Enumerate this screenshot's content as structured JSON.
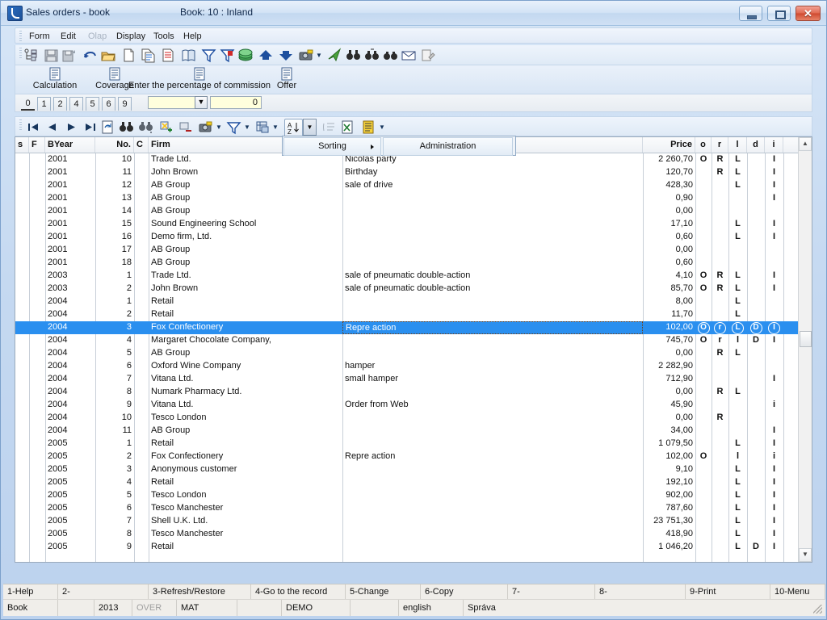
{
  "window": {
    "title": "Sales orders - book",
    "book_label": "Book: 10 : Inland",
    "app_icon": "book-app-icon",
    "minimize": "–",
    "maximize": "□",
    "close": "✕"
  },
  "menubar": {
    "items": [
      {
        "label": "Form",
        "disabled": false
      },
      {
        "label": "Edit",
        "disabled": false
      },
      {
        "label": "Olap",
        "disabled": true
      },
      {
        "label": "Display",
        "disabled": false
      },
      {
        "label": "Tools",
        "disabled": false
      },
      {
        "label": "Help",
        "disabled": false
      }
    ]
  },
  "toolbar_main": {
    "icons": [
      "structure-tree-icon",
      "save-icon",
      "save-lock-icon",
      "undo-icon",
      "open-folder-icon",
      "new-document-icon",
      "copy-document-icon",
      "paste-document-icon",
      "book-icon",
      "filter-icon",
      "filter-remove-icon",
      "money-stack-icon",
      "move-up-icon",
      "move-down-icon",
      "camera-icon",
      "camera-dropdown-icon",
      "mail-send-icon",
      "binoculars-icon",
      "binoculars-next-icon",
      "binoculars-prev-icon",
      "envelope-icon",
      "edit-note-icon"
    ]
  },
  "toolbar_buttons": {
    "items": [
      {
        "label": "Calculation",
        "icon": "document-icon"
      },
      {
        "label": "Coverage",
        "icon": "document-icon"
      },
      {
        "label": "Enter the percentage of commission",
        "icon": "document-icon"
      },
      {
        "label": "Offer",
        "icon": "document-icon"
      }
    ]
  },
  "tabs": {
    "items": [
      "0",
      "1",
      "2",
      "4",
      "5",
      "6",
      "9"
    ],
    "active": "0",
    "combo_value": "",
    "number_value": "0"
  },
  "toolbar_grid": {
    "icons": [
      "first-record-icon",
      "previous-record-icon",
      "next-record-icon",
      "last-record-icon",
      "refresh-record-icon",
      "find-icon",
      "find-next-icon",
      "add-record-icon",
      "delete-record-icon",
      "camera-icon",
      "filter-icon",
      "grid-layout-icon",
      "sort-az-icon",
      "list-icon",
      "export-excel-icon",
      "report-icon"
    ]
  },
  "dropdown": {
    "sorting_label": "Sorting",
    "administration_label": "Administration",
    "submenu_arrow": "▶"
  },
  "grid": {
    "columns": [
      {
        "key": "s",
        "label": "s",
        "align": "left"
      },
      {
        "key": "f",
        "label": "F",
        "align": "left"
      },
      {
        "key": "byear",
        "label": "BYear",
        "align": "left"
      },
      {
        "key": "no",
        "label": "No.",
        "align": "right"
      },
      {
        "key": "c",
        "label": "C",
        "align": "left"
      },
      {
        "key": "firm",
        "label": "Firm",
        "align": "left"
      },
      {
        "key": "desc",
        "label": "",
        "align": "left"
      },
      {
        "key": "price",
        "label": "Price",
        "align": "right"
      },
      {
        "key": "o",
        "label": "o",
        "align": "center"
      },
      {
        "key": "r",
        "label": "r",
        "align": "center"
      },
      {
        "key": "l",
        "label": "l",
        "align": "center"
      },
      {
        "key": "d",
        "label": "d",
        "align": "center"
      },
      {
        "key": "i",
        "label": "i",
        "align": "center"
      }
    ],
    "rows": [
      {
        "s": "",
        "f": "",
        "byear": "2001",
        "no": "10",
        "c": "",
        "firm": "Trade Ltd.",
        "desc": "Nicolas party",
        "price": "2 260,70",
        "o": "O",
        "r": "R",
        "l": "L",
        "d": "",
        "i": "I",
        "selected": false
      },
      {
        "s": "",
        "f": "",
        "byear": "2001",
        "no": "11",
        "c": "",
        "firm": "John Brown",
        "desc": "Birthday",
        "price": "120,70",
        "o": "",
        "r": "R",
        "l": "L",
        "d": "",
        "i": "I",
        "selected": false
      },
      {
        "s": "",
        "f": "",
        "byear": "2001",
        "no": "12",
        "c": "",
        "firm": "AB Group",
        "desc": "sale of drive",
        "price": "428,30",
        "o": "",
        "r": "",
        "l": "L",
        "d": "",
        "i": "I",
        "selected": false
      },
      {
        "s": "",
        "f": "",
        "byear": "2001",
        "no": "13",
        "c": "",
        "firm": "AB Group",
        "desc": "",
        "price": "0,90",
        "o": "",
        "r": "",
        "l": "",
        "d": "",
        "i": "I",
        "selected": false
      },
      {
        "s": "",
        "f": "",
        "byear": "2001",
        "no": "14",
        "c": "",
        "firm": "AB Group",
        "desc": "",
        "price": "0,00",
        "o": "",
        "r": "",
        "l": "",
        "d": "",
        "i": "",
        "selected": false
      },
      {
        "s": "",
        "f": "",
        "byear": "2001",
        "no": "15",
        "c": "",
        "firm": "Sound Engineering School",
        "desc": "",
        "price": "17,10",
        "o": "",
        "r": "",
        "l": "L",
        "d": "",
        "i": "I",
        "selected": false
      },
      {
        "s": "",
        "f": "",
        "byear": "2001",
        "no": "16",
        "c": "",
        "firm": "Demo firm, Ltd.",
        "desc": "",
        "price": "0,60",
        "o": "",
        "r": "",
        "l": "L",
        "d": "",
        "i": "I",
        "selected": false
      },
      {
        "s": "",
        "f": "",
        "byear": "2001",
        "no": "17",
        "c": "",
        "firm": "AB Group",
        "desc": "",
        "price": "0,00",
        "o": "",
        "r": "",
        "l": "",
        "d": "",
        "i": "",
        "selected": false
      },
      {
        "s": "",
        "f": "",
        "byear": "2001",
        "no": "18",
        "c": "",
        "firm": "AB Group",
        "desc": "",
        "price": "0,60",
        "o": "",
        "r": "",
        "l": "",
        "d": "",
        "i": "",
        "selected": false
      },
      {
        "s": "",
        "f": "",
        "byear": "2003",
        "no": "1",
        "c": "",
        "firm": "Trade Ltd.",
        "desc": "sale of pneumatic double-action",
        "price": "4,10",
        "o": "O",
        "r": "R",
        "l": "L",
        "d": "",
        "i": "I",
        "selected": false
      },
      {
        "s": "",
        "f": "",
        "byear": "2003",
        "no": "2",
        "c": "",
        "firm": "John Brown",
        "desc": "sale of pneumatic double-action",
        "price": "85,70",
        "o": "O",
        "r": "R",
        "l": "L",
        "d": "",
        "i": "I",
        "selected": false
      },
      {
        "s": "",
        "f": "",
        "byear": "2004",
        "no": "1",
        "c": "",
        "firm": "Retail",
        "desc": "",
        "price": "8,00",
        "o": "",
        "r": "",
        "l": "L",
        "d": "",
        "i": "",
        "selected": false
      },
      {
        "s": "",
        "f": "",
        "byear": "2004",
        "no": "2",
        "c": "",
        "firm": "Retail",
        "desc": "",
        "price": "11,70",
        "o": "",
        "r": "",
        "l": "L",
        "d": "",
        "i": "",
        "selected": false
      },
      {
        "s": "",
        "f": "",
        "byear": "2004",
        "no": "3",
        "c": "",
        "firm": "Fox Confectionery",
        "desc": "Repre action",
        "price": "102,00",
        "o": "O",
        "r": "r",
        "l": "L",
        "d": "D",
        "i": "I",
        "selected": true
      },
      {
        "s": "",
        "f": "",
        "byear": "2004",
        "no": "4",
        "c": "",
        "firm": "Margaret Chocolate Company,",
        "desc": "",
        "price": "745,70",
        "o": "O",
        "r": "r",
        "l": "l",
        "d": "D",
        "i": "I",
        "selected": false
      },
      {
        "s": "",
        "f": "",
        "byear": "2004",
        "no": "5",
        "c": "",
        "firm": "AB Group",
        "desc": "",
        "price": "0,00",
        "o": "",
        "r": "R",
        "l": "L",
        "d": "",
        "i": "",
        "selected": false
      },
      {
        "s": "",
        "f": "",
        "byear": "2004",
        "no": "6",
        "c": "",
        "firm": "Oxford Wine Company",
        "desc": "hamper",
        "price": "2 282,90",
        "o": "",
        "r": "",
        "l": "",
        "d": "",
        "i": "",
        "selected": false
      },
      {
        "s": "",
        "f": "",
        "byear": "2004",
        "no": "7",
        "c": "",
        "firm": "Vitana Ltd.",
        "desc": "small hamper",
        "price": "712,90",
        "o": "",
        "r": "",
        "l": "",
        "d": "",
        "i": "I",
        "selected": false
      },
      {
        "s": "",
        "f": "",
        "byear": "2004",
        "no": "8",
        "c": "",
        "firm": "Numark Pharmacy Ltd.",
        "desc": "",
        "price": "0,00",
        "o": "",
        "r": "R",
        "l": "L",
        "d": "",
        "i": "",
        "selected": false
      },
      {
        "s": "",
        "f": "",
        "byear": "2004",
        "no": "9",
        "c": "",
        "firm": "Vitana Ltd.",
        "desc": "Order from Web",
        "price": "45,90",
        "o": "",
        "r": "",
        "l": "",
        "d": "",
        "i": "i",
        "selected": false
      },
      {
        "s": "",
        "f": "",
        "byear": "2004",
        "no": "10",
        "c": "",
        "firm": "Tesco London",
        "desc": "",
        "price": "0,00",
        "o": "",
        "r": "R",
        "l": "",
        "d": "",
        "i": "",
        "selected": false
      },
      {
        "s": "",
        "f": "",
        "byear": "2004",
        "no": "11",
        "c": "",
        "firm": "AB Group",
        "desc": "",
        "price": "34,00",
        "o": "",
        "r": "",
        "l": "",
        "d": "",
        "i": "I",
        "selected": false
      },
      {
        "s": "",
        "f": "",
        "byear": "2005",
        "no": "1",
        "c": "",
        "firm": "Retail",
        "desc": "",
        "price": "1 079,50",
        "o": "",
        "r": "",
        "l": "L",
        "d": "",
        "i": "I",
        "selected": false
      },
      {
        "s": "",
        "f": "",
        "byear": "2005",
        "no": "2",
        "c": "",
        "firm": "Fox Confectionery",
        "desc": "Repre action",
        "price": "102,00",
        "o": "O",
        "r": "",
        "l": "l",
        "d": "",
        "i": "i",
        "selected": false
      },
      {
        "s": "",
        "f": "",
        "byear": "2005",
        "no": "3",
        "c": "",
        "firm": "Anonymous customer",
        "desc": "",
        "price": "9,10",
        "o": "",
        "r": "",
        "l": "L",
        "d": "",
        "i": "I",
        "selected": false
      },
      {
        "s": "",
        "f": "",
        "byear": "2005",
        "no": "4",
        "c": "",
        "firm": "Retail",
        "desc": "",
        "price": "192,10",
        "o": "",
        "r": "",
        "l": "L",
        "d": "",
        "i": "I",
        "selected": false
      },
      {
        "s": "",
        "f": "",
        "byear": "2005",
        "no": "5",
        "c": "",
        "firm": "Tesco London",
        "desc": "",
        "price": "902,00",
        "o": "",
        "r": "",
        "l": "L",
        "d": "",
        "i": "I",
        "selected": false
      },
      {
        "s": "",
        "f": "",
        "byear": "2005",
        "no": "6",
        "c": "",
        "firm": "Tesco Manchester",
        "desc": "",
        "price": "787,60",
        "o": "",
        "r": "",
        "l": "L",
        "d": "",
        "i": "I",
        "selected": false
      },
      {
        "s": "",
        "f": "",
        "byear": "2005",
        "no": "7",
        "c": "",
        "firm": "Shell U.K. Ltd.",
        "desc": "",
        "price": "23 751,30",
        "o": "",
        "r": "",
        "l": "L",
        "d": "",
        "i": "I",
        "selected": false
      },
      {
        "s": "",
        "f": "",
        "byear": "2005",
        "no": "8",
        "c": "",
        "firm": "Tesco Manchester",
        "desc": "",
        "price": "418,90",
        "o": "",
        "r": "",
        "l": "L",
        "d": "",
        "i": "I",
        "selected": false
      },
      {
        "s": "",
        "f": "",
        "byear": "2005",
        "no": "9",
        "c": "",
        "firm": "Retail",
        "desc": "",
        "price": "1 046,20",
        "o": "",
        "r": "",
        "l": "L",
        "d": "D",
        "i": "I",
        "selected": false
      }
    ]
  },
  "scrollbar": {
    "up_arrow": "▲",
    "down_arrow": "▼"
  },
  "function_keys": [
    {
      "label": "1-Help"
    },
    {
      "label": "2-"
    },
    {
      "label": "3-Refresh/Restore"
    },
    {
      "label": "4-Go to the record"
    },
    {
      "label": "5-Change"
    },
    {
      "label": "6-Copy"
    },
    {
      "label": "7-"
    },
    {
      "label": "8-"
    },
    {
      "label": "9-Print"
    },
    {
      "label": "10-Menu"
    }
  ],
  "statusbar": {
    "cells": [
      {
        "label": "Book",
        "dim": false
      },
      {
        "label": "",
        "dim": false
      },
      {
        "label": "2013",
        "dim": false
      },
      {
        "label": "OVER",
        "dim": true
      },
      {
        "label": "MAT",
        "dim": false
      },
      {
        "label": "",
        "dim": false
      },
      {
        "label": "DEMO",
        "dim": false
      },
      {
        "label": "",
        "dim": false
      },
      {
        "label": "english",
        "dim": false
      },
      {
        "label": "Správa",
        "dim": false
      }
    ]
  },
  "colors": {
    "selection": "#2a8fef",
    "title_text": "#10284a",
    "field_yellow": "#ffffdd"
  }
}
